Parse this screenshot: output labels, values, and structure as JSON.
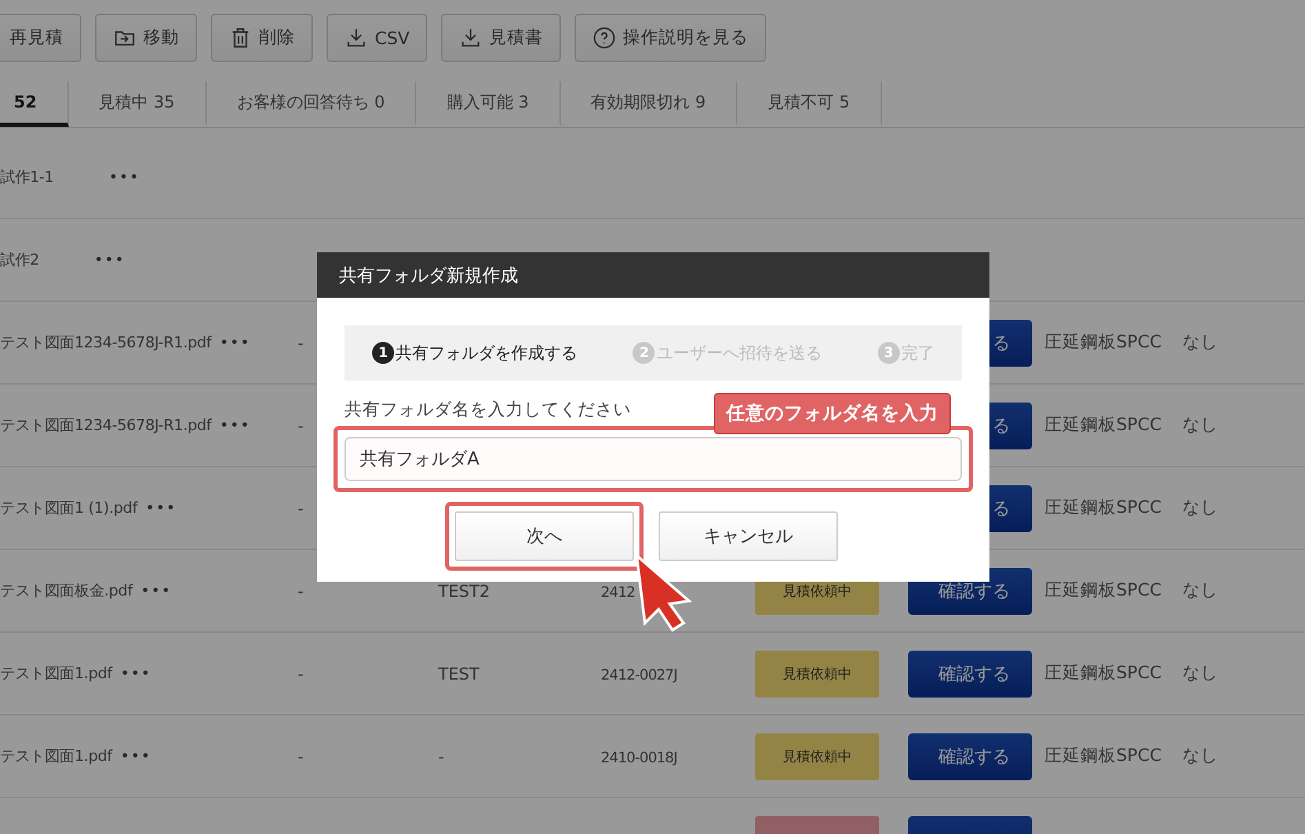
{
  "toolbar": [
    {
      "label": "再見積"
    },
    {
      "label": "移動"
    },
    {
      "label": "削除"
    },
    {
      "label": "CSV"
    },
    {
      "label": "見積書"
    },
    {
      "label": "操作説明を見る"
    }
  ],
  "tabs": [
    {
      "label": "52",
      "selected": true
    },
    {
      "label": "見積中 35",
      "selected": false
    },
    {
      "label": "お客様の回答待ち 0",
      "selected": false
    },
    {
      "label": "購入可能 3",
      "selected": false
    },
    {
      "label": "有効期限切れ 9",
      "selected": false
    },
    {
      "label": "見積不可 5",
      "selected": false
    }
  ],
  "rows": [
    {
      "kind": "folder",
      "name": "試作1-1",
      "menu": "•••"
    },
    {
      "kind": "folder",
      "name": "試作2",
      "menu": "•••"
    },
    {
      "kind": "file",
      "name": "テスト図面1234-5678J-R1.pdf",
      "menu": "•••",
      "note": "-",
      "action": "る",
      "material": "圧延鋼板SPCC",
      "option": "なし"
    },
    {
      "kind": "file",
      "name": "テスト図面1234-5678J-R1.pdf",
      "menu": "•••",
      "note": "-",
      "action": "る",
      "material": "圧延鋼板SPCC",
      "option": "なし"
    },
    {
      "kind": "file",
      "name": "テスト図面1 (1).pdf",
      "menu": "•••",
      "note": "-",
      "action": "る",
      "material": "圧延鋼板SPCC",
      "option": "なし"
    },
    {
      "kind": "file",
      "name": "テスト図面板金.pdf",
      "menu": "•••",
      "note": "-",
      "client": "TEST2",
      "number": "2412",
      "status": {
        "kind": "requested",
        "label": "見積依頼中"
      },
      "action": "確認する",
      "material": "圧延鋼板SPCC",
      "option": "なし"
    },
    {
      "kind": "file",
      "name": "テスト図面1.pdf",
      "menu": "•••",
      "note": "-",
      "client": "TEST",
      "number": "2412-0027J",
      "status": {
        "kind": "requested",
        "label": "見積依頼中"
      },
      "action": "確認する",
      "material": "圧延鋼板SPCC",
      "option": "なし"
    },
    {
      "kind": "file",
      "name": "テスト図面1.pdf",
      "menu": "•••",
      "note": "-",
      "client": "-",
      "number": "2410-0018J",
      "status": {
        "kind": "requested",
        "label": "見積依頼中"
      },
      "action": "確認する",
      "material": "圧延鋼板SPCC",
      "option": "なし"
    },
    {
      "kind": "file",
      "status": {
        "kind": "declined"
      }
    }
  ],
  "dialog": {
    "title": "共有フォルダ新規作成",
    "steps": [
      {
        "number": "1",
        "label": "共有フォルダを作成する",
        "selected": true
      },
      {
        "number": "2",
        "label": "ユーザーへ招待を送る",
        "selected": false
      },
      {
        "number": "3",
        "label": "完了",
        "selected": false
      }
    ],
    "field_label": "共有フォルダ名を入力してください",
    "callout": "任意のフォルダ名を入力",
    "value": "共有フォルダA",
    "buttons": [
      {
        "label": "次へ",
        "highlighted": true
      },
      {
        "label": "キャンセル",
        "highlighted": false
      }
    ]
  }
}
